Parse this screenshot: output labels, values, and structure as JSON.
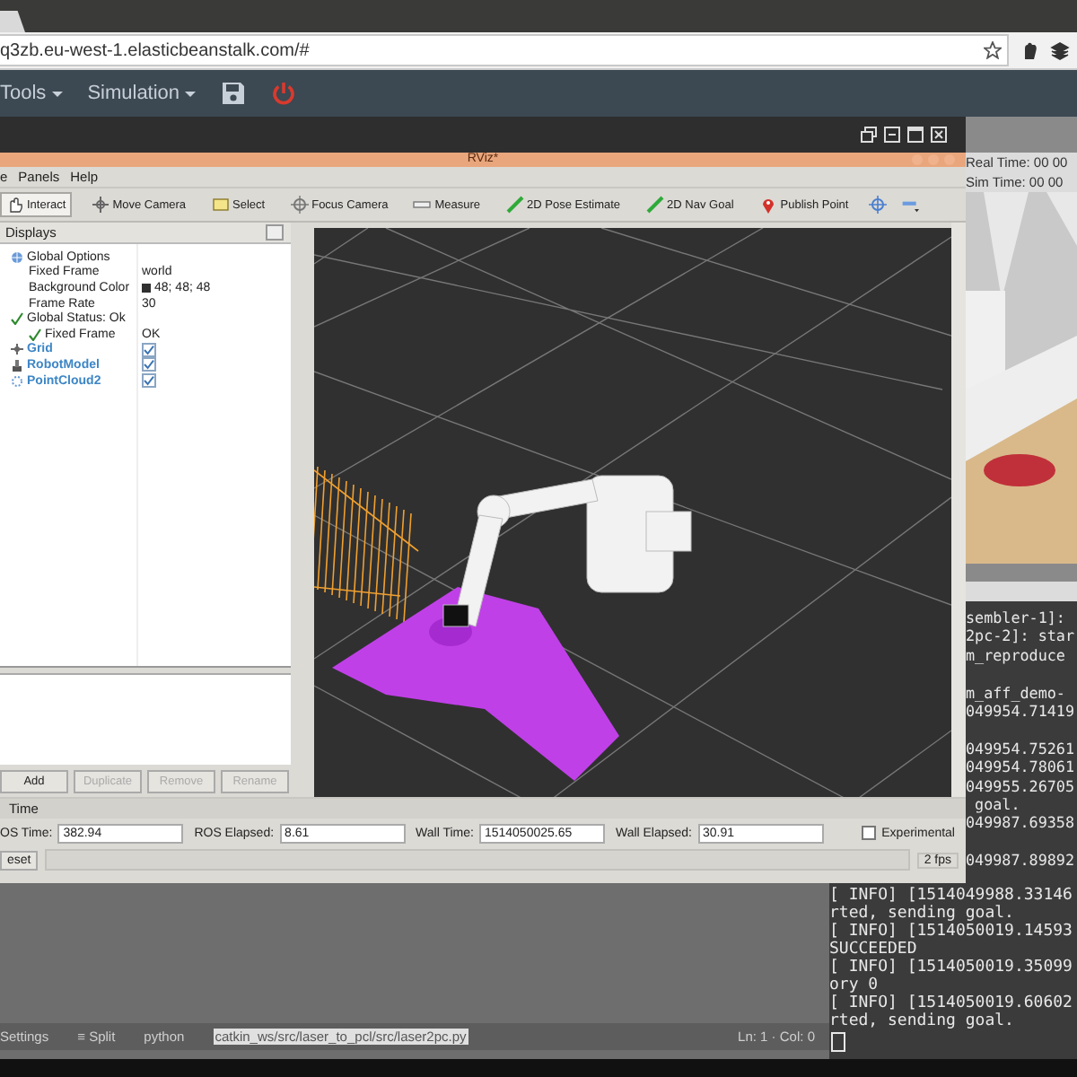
{
  "browser": {
    "url": "q3zb.eu-west-1.elasticbeanstalk.com/#"
  },
  "app_nav": [
    {
      "label": "Tools"
    },
    {
      "label": "Simulation"
    }
  ],
  "rviz": {
    "title": "RViz*",
    "menu": [
      "e",
      "Panels",
      "Help"
    ],
    "toolbar": [
      {
        "label": "Interact",
        "selected": true
      },
      {
        "label": "Move Camera",
        "selected": false
      },
      {
        "label": "Select",
        "selected": false
      },
      {
        "label": "Focus Camera",
        "selected": false
      },
      {
        "label": "Measure",
        "selected": false
      },
      {
        "label": "2D Pose Estimate",
        "selected": false
      },
      {
        "label": "2D Nav Goal",
        "selected": false
      },
      {
        "label": "Publish Point",
        "selected": false
      }
    ],
    "displays": {
      "title": "Displays",
      "tree": [
        {
          "kind": "options",
          "label": "Global Options",
          "children": [
            {
              "kind": "property",
              "label": "Fixed Frame",
              "value": "world"
            },
            {
              "kind": "color_property",
              "label": "Background Color",
              "value": "48; 48; 48"
            },
            {
              "kind": "property",
              "label": "Frame Rate",
              "value": "30"
            }
          ]
        },
        {
          "kind": "status",
          "label": "Global Status: Ok",
          "children": [
            {
              "kind": "status",
              "label": "Fixed Frame",
              "value": "OK"
            }
          ]
        },
        {
          "kind": "grid",
          "label": "Grid",
          "checked": true
        },
        {
          "kind": "robot",
          "label": "RobotModel",
          "checked": true
        },
        {
          "kind": "cloud",
          "label": "PointCloud2",
          "checked": true
        }
      ],
      "buttons": [
        {
          "label": "Add",
          "disabled": false
        },
        {
          "label": "Duplicate",
          "disabled": true
        },
        {
          "label": "Remove",
          "disabled": true
        },
        {
          "label": "Rename",
          "disabled": true
        }
      ]
    },
    "time": {
      "title": "Time",
      "fields": [
        {
          "label": "OS Time:",
          "value": "382.94"
        },
        {
          "label": "ROS Elapsed:",
          "value": "8.61"
        },
        {
          "label": "Wall Time:",
          "value": "1514050025.65"
        },
        {
          "label": "Wall Elapsed:",
          "value": "30.91"
        }
      ],
      "experimental": {
        "label": "Experimental",
        "checked": false
      },
      "reset": "eset",
      "fps": "2 fps"
    }
  },
  "gazebo": {
    "real_time": "Real Time: 00 00",
    "sim_time": "Sim Time: 00 00"
  },
  "terminal": {
    "upper_lines": [
      {
        "text": "sembler-1]:",
        "gap_before": false
      },
      {
        "text": "2pc-2]: star",
        "gap_before": false
      },
      {
        "text": "m_reproduce",
        "gap_before": false
      },
      {
        "text": "m_aff_demo-",
        "gap_before": true
      },
      {
        "text": "049954.71419",
        "gap_before": false
      },
      {
        "text": "049954.75261",
        "gap_before": true
      },
      {
        "text": "049954.78061",
        "gap_before": false
      },
      {
        "text": "049955.26705",
        "gap_before": false
      },
      {
        "text": " goal.",
        "gap_before": false
      },
      {
        "text": "049987.69358",
        "gap_before": false
      },
      {
        "text": "049987.89892",
        "gap_before": true
      }
    ],
    "lines": [
      "[ INFO] [1514049988.33146",
      "rted, sending goal.",
      "[ INFO] [1514050019.14593",
      "SUCCEEDED",
      "[ INFO] [1514050019.35099",
      "ory 0",
      "[ INFO] [1514050019.60602",
      "rted, sending goal."
    ]
  },
  "editor_status": {
    "items": [
      "Settings",
      "≡ Split",
      "python"
    ],
    "file": "catkin_ws/src/laser_to_pcl/src/laser2pc.py",
    "position": "Ln: 1 · Col: 0"
  }
}
